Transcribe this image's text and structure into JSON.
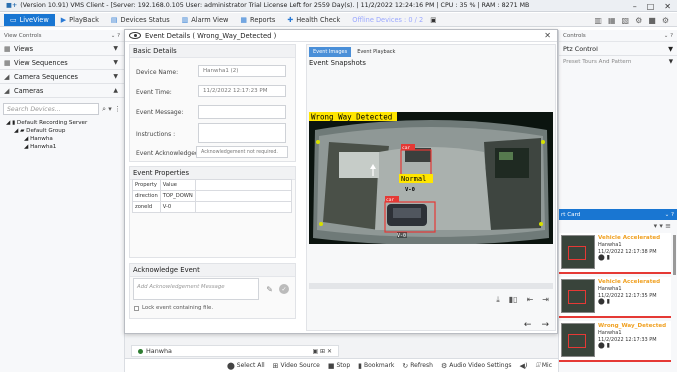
{
  "titlebar": {
    "logo": "■+",
    "text": "(Version 10.91) VMS Client - [Server: 192.168.0.105  User: administrator Trial License Left for 2559 Day(s). | 11/2/2022 12:24:16 PM | CPU : 35 % | RAM : 8271 MB",
    "min": "–",
    "max": "□",
    "close": "✕"
  },
  "menubar": {
    "items": [
      {
        "label": "LiveView",
        "icon": "▭",
        "active": true
      },
      {
        "label": "PlayBack",
        "icon": "▶",
        "active": false
      },
      {
        "label": "Devices Status",
        "icon": "▤",
        "active": false
      },
      {
        "label": "Alarm View",
        "icon": "▥",
        "active": false
      },
      {
        "label": "Reports",
        "icon": "▦",
        "active": false
      },
      {
        "label": "Health Check",
        "icon": "✚",
        "active": false
      }
    ],
    "offline": "Offline Devices : 0 / 2",
    "offline_icon": "▣",
    "right_icons": [
      "▥",
      "▦",
      "▧",
      "⚙",
      "■",
      "⚙"
    ]
  },
  "left": {
    "header": "View Controls",
    "header_ctrl": "⌄  ?",
    "sections": [
      {
        "label": "Views",
        "icon": "▦"
      },
      {
        "label": "View Sequences",
        "icon": "▦"
      },
      {
        "label": "Camera Sequences",
        "icon": "◢"
      },
      {
        "label": "Cameras",
        "icon": "◢"
      }
    ],
    "search_placeholder": "Search Devices...",
    "search_icons": "⌕ ▾ ⋮",
    "tree": [
      "◢  ▮  Default Recording Server",
      "◢  ▰  Default Group",
      "◢  Hanwha",
      "◢  Hanwha1"
    ]
  },
  "dialog": {
    "title": "Event Details ( Wrong_Way_Detected )",
    "close": "✕",
    "basic": {
      "title": "Basic Details",
      "device_label": "Device Name:",
      "device_value": "Hanwha1 (2)",
      "time_label": "Event Time:",
      "time_value": "11/2/2022 12:17:23 PM",
      "message_label": "Event Message:",
      "message_value": "",
      "instructions_label": "Instructions :",
      "instructions_value": "",
      "ack_label": "Event Acknowledged:",
      "ack_value": "Acknowledgement not required."
    },
    "props": {
      "title": "Event Properties",
      "headers": [
        "Property",
        "Value"
      ],
      "rows": [
        [
          "direction",
          "TOP_DOWN"
        ],
        [
          "zoneId",
          "V-0"
        ]
      ]
    },
    "ack": {
      "title": "Acknowledge Event",
      "placeholder": "Add Acknowledgement Message",
      "edit_icon": "✎",
      "ok_icon": "✓",
      "lock_label": "Lock event containing file."
    },
    "snap": {
      "tabs": [
        "Event Images",
        "Event Playback"
      ],
      "title": "Event Snapshots",
      "overlay_label": "Wrong_Way_Detected",
      "car_label_1": "car",
      "car_label_2": "car",
      "normal_label": "Normal",
      "v0_label": "V-0",
      "zone_label": "V-0",
      "actions": [
        "⤓",
        "▮▯",
        "⇤",
        "⇥"
      ],
      "nav": [
        "←",
        "→"
      ]
    }
  },
  "right": {
    "header": "Controls",
    "header_ctrl": "⌄  ?",
    "ptz": "Ptz Control",
    "preset": "Preset Tours And Pattern",
    "alarm_header": "rt Card",
    "alarm_ctrl": "⌄  ?",
    "alarm_tools": "▾ ▾ ≡",
    "cards": [
      {
        "type": "Vehicle Accelerated",
        "device": "Hanwha1",
        "time": "11/2/2022 12:17:38 PM",
        "icons": "⬤ ▮"
      },
      {
        "type": "Vehicle Accelerated",
        "device": "Hanwha1",
        "time": "11/2/2022 12:17:35 PM",
        "icons": "⬤ ▮"
      },
      {
        "type": "Wrong_Way_Detected",
        "device": "Hanwha1",
        "time": "11/2/2022 12:17:33 PM",
        "icons": "⬤ ▮"
      }
    ]
  },
  "bottom": {
    "camera": "Hanwha",
    "cam_ctrl": "▣ ⊞ ✕",
    "actions": [
      {
        "label": "Select All",
        "icon": "⬤"
      },
      {
        "label": "Video Source",
        "icon": "⊞"
      },
      {
        "label": "Stop",
        "icon": "■"
      },
      {
        "label": "Bookmark",
        "icon": "▮"
      },
      {
        "label": "Refresh",
        "icon": "↻"
      },
      {
        "label": "Audio Video Settings",
        "icon": "⚙"
      },
      {
        "label": "",
        "icon": "◀)"
      },
      {
        "label": "Mic",
        "icon": "🎙"
      }
    ]
  }
}
